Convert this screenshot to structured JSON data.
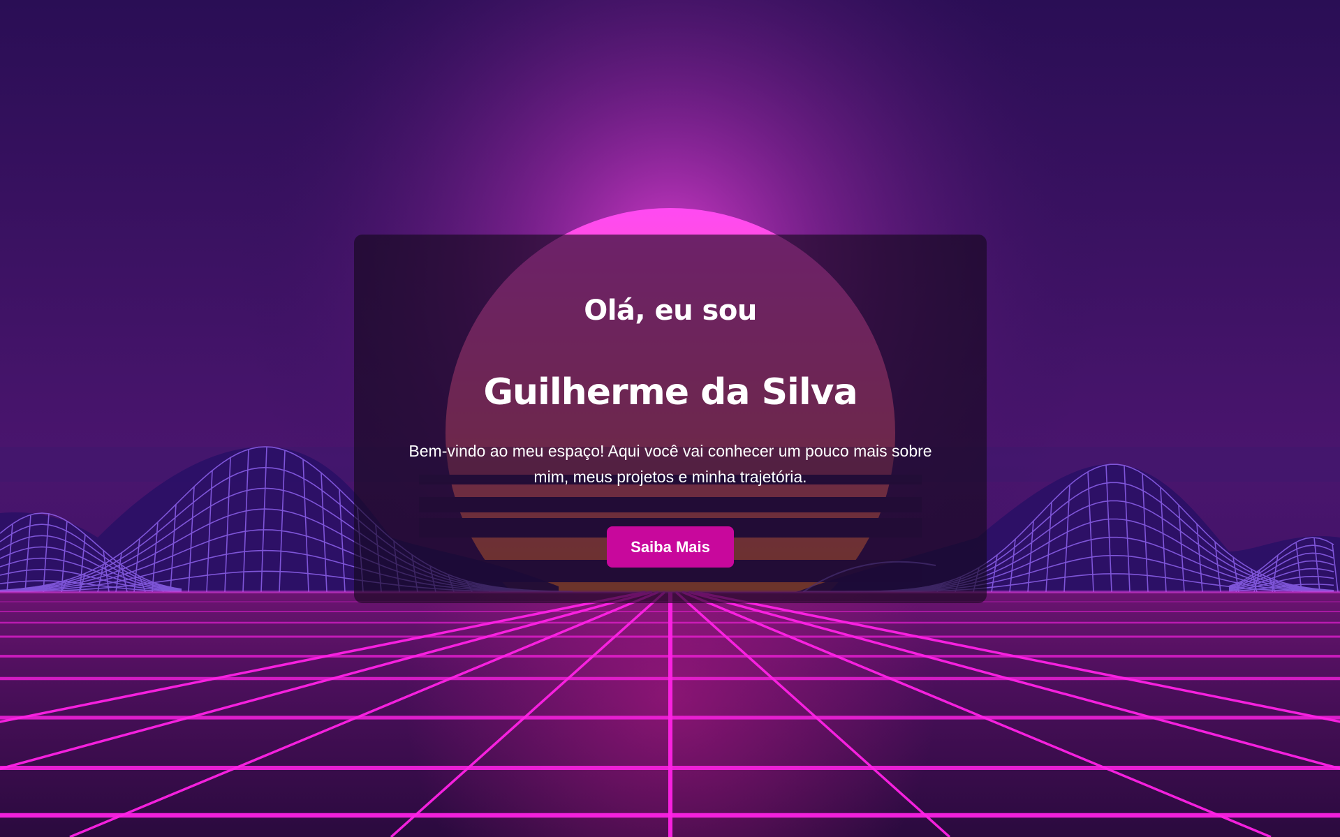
{
  "hero": {
    "greeting": "Olá, eu sou",
    "name": "Guilherme da Silva",
    "intro": "Bem-vindo ao meu espaço! Aqui você vai conhecer um pouco mais sobre mim, meus projetos e minha trajetória.",
    "cta_label": "Saiba Mais"
  },
  "colors": {
    "sky_top": "#1e0b45",
    "sky_glow": "#8a1f9e",
    "sun_top": "#ff45f0",
    "sun_bottom": "#ff7a1a",
    "grid_line": "#ff22e6",
    "mountain_line": "#9a6cff",
    "accent": "#c8089c"
  }
}
